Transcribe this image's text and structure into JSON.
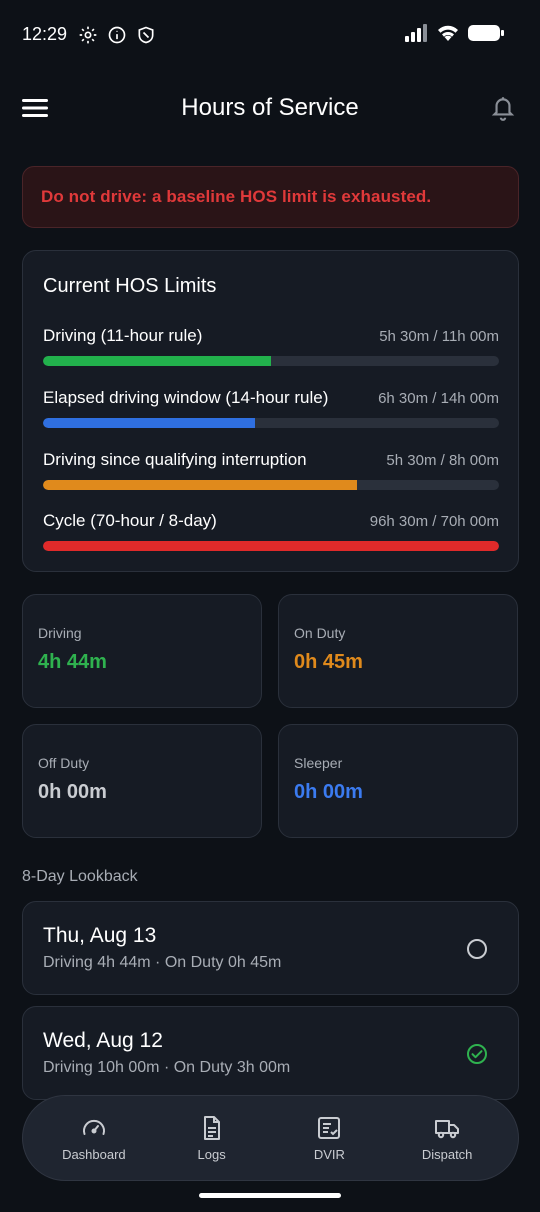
{
  "status_bar": {
    "time": "12:29",
    "icons_left": [
      "gear-icon",
      "info-icon",
      "shield-icon"
    ],
    "icons_right": [
      "signal-icon",
      "wifi-icon",
      "battery-icon"
    ]
  },
  "header": {
    "title": "Hours of Service",
    "menu_icon": "hamburger-menu-icon",
    "notification_icon": "bell-icon"
  },
  "alert": {
    "text": "Do not drive: a baseline HOS limit is exhausted.",
    "color": "#e0393a"
  },
  "limits": {
    "title": "Current HOS Limits",
    "items": [
      {
        "label": "Driving (11-hour rule)",
        "value": "5h 30m / 11h 00m",
        "fraction": 0.5,
        "color": "#22b14c"
      },
      {
        "label": "Elapsed driving window (14-hour rule)",
        "value": "6h 30m / 14h 00m",
        "fraction": 0.4643,
        "color": "#2f6fe0"
      },
      {
        "label": "Driving since qualifying interruption",
        "value": "5h 30m / 8h 00m",
        "fraction": 0.6875,
        "color": "#e08a1c"
      },
      {
        "label": "Cycle (70-hour / 8-day)",
        "value": "96h 30m / 70h 00m",
        "fraction": 1.0,
        "color": "#e02a2a"
      }
    ]
  },
  "stats": [
    {
      "label": "Driving",
      "value": "4h 44m",
      "color": "#2fb24f"
    },
    {
      "label": "On Duty",
      "value": "0h 45m",
      "color": "#e08a1c"
    },
    {
      "label": "Off Duty",
      "value": "0h 00m",
      "color": "#c9ccd1"
    },
    {
      "label": "Sleeper",
      "value": "0h 00m",
      "color": "#3b7bf0"
    }
  ],
  "lookback": {
    "heading": "8-Day Lookback",
    "days": [
      {
        "date": "Thu, Aug 13",
        "summary": "Driving 4h 44m · On Duty 0h 45m",
        "status_icon": "circle-outline-icon"
      },
      {
        "date": "Wed, Aug 12",
        "summary": "Driving 10h 00m · On Duty 3h 00m",
        "status_icon": "check-circle-icon"
      }
    ]
  },
  "bottom_nav": {
    "items": [
      {
        "label": "Dashboard",
        "icon": "speedometer-icon"
      },
      {
        "label": "Logs",
        "icon": "document-icon"
      },
      {
        "label": "DVIR",
        "icon": "checklist-icon"
      },
      {
        "label": "Dispatch",
        "icon": "truck-icon"
      }
    ]
  }
}
